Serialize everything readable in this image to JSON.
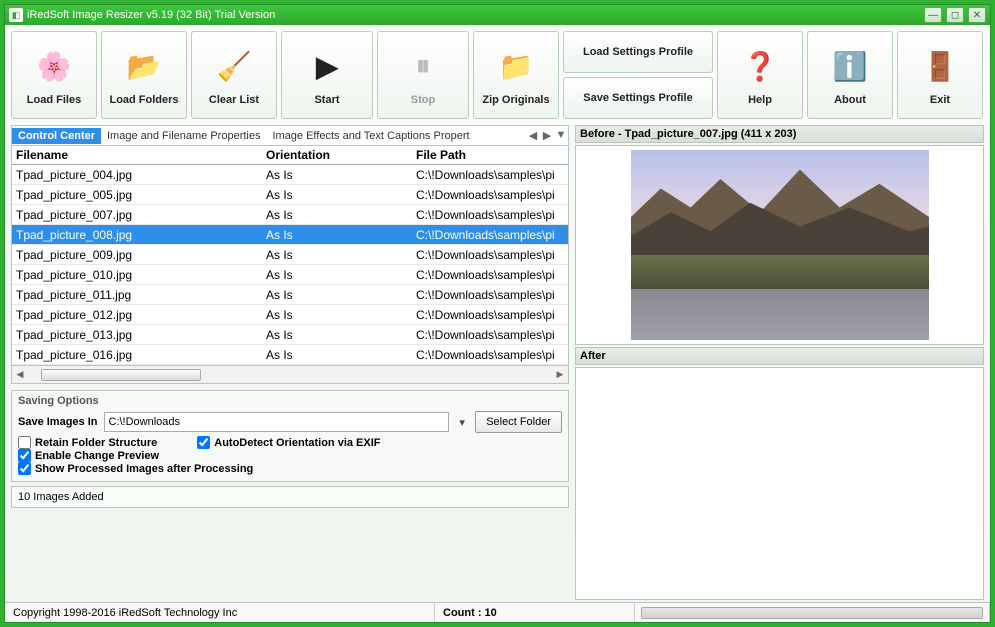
{
  "window": {
    "title": "iRedSoft Image Resizer v5.19 (32 Bit) Trial Version"
  },
  "toolbar": {
    "load_files": "Load Files",
    "load_folders": "Load Folders",
    "clear_list": "Clear List",
    "start": "Start",
    "stop": "Stop",
    "zip_originals": "Zip Originals",
    "load_profile": "Load Settings Profile",
    "save_profile": "Save Settings Profile",
    "help": "Help",
    "about": "About",
    "exit": "Exit"
  },
  "tabs": {
    "control_center": "Control Center",
    "image_props": "Image and Filename Properties",
    "effects": "Image Effects and Text Captions Propert"
  },
  "grid": {
    "headers": {
      "filename": "Filename",
      "orientation": "Orientation",
      "filepath": "File Path"
    },
    "rows": [
      {
        "filename": "Tpad_picture_004.jpg",
        "orientation": "As Is",
        "filepath": "C:\\!Downloads\\samples\\pi"
      },
      {
        "filename": "Tpad_picture_005.jpg",
        "orientation": "As Is",
        "filepath": "C:\\!Downloads\\samples\\pi"
      },
      {
        "filename": "Tpad_picture_007.jpg",
        "orientation": "As Is",
        "filepath": "C:\\!Downloads\\samples\\pi"
      },
      {
        "filename": "Tpad_picture_008.jpg",
        "orientation": "As Is",
        "filepath": "C:\\!Downloads\\samples\\pi",
        "selected": true
      },
      {
        "filename": "Tpad_picture_009.jpg",
        "orientation": "As Is",
        "filepath": "C:\\!Downloads\\samples\\pi"
      },
      {
        "filename": "Tpad_picture_010.jpg",
        "orientation": "As Is",
        "filepath": "C:\\!Downloads\\samples\\pi"
      },
      {
        "filename": "Tpad_picture_011.jpg",
        "orientation": "As Is",
        "filepath": "C:\\!Downloads\\samples\\pi"
      },
      {
        "filename": "Tpad_picture_012.jpg",
        "orientation": "As Is",
        "filepath": "C:\\!Downloads\\samples\\pi"
      },
      {
        "filename": "Tpad_picture_013.jpg",
        "orientation": "As Is",
        "filepath": "C:\\!Downloads\\samples\\pi"
      },
      {
        "filename": "Tpad_picture_016.jpg",
        "orientation": "As Is",
        "filepath": "C:\\!Downloads\\samples\\pi"
      }
    ]
  },
  "saving": {
    "heading": "Saving Options",
    "save_in_label": "Save Images In",
    "save_in_value": "C:\\!Downloads",
    "select_folder": "Select Folder",
    "retain": "Retain Folder Structure",
    "autodetect": "AutoDetect Orientation via EXIF",
    "enable_preview": "Enable Change Preview",
    "show_processed": "Show Processed Images after Processing"
  },
  "status_small": "10 Images Added",
  "preview": {
    "before_label": "Before - Tpad_picture_007.jpg (411 x 203)",
    "after_label": "After"
  },
  "footer": {
    "copyright": "Copyright 1998-2016 iRedSoft Technology Inc",
    "count": "Count : 10"
  }
}
